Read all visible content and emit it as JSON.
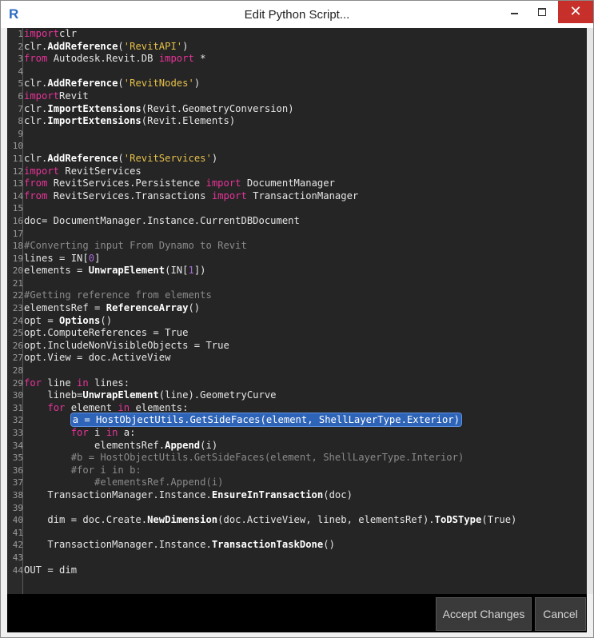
{
  "window": {
    "title": "Edit Python Script...",
    "app_icon_letter": "R",
    "close_glyph": "✕"
  },
  "editor": {
    "lines": [
      {
        "n": "1",
        "t": [
          [
            "kw",
            "import"
          ],
          [
            "",
            "clr"
          ]
        ]
      },
      {
        "n": "2",
        "t": [
          [
            "",
            "clr."
          ],
          [
            "fn",
            "AddReference"
          ],
          [
            "",
            "("
          ],
          [
            "str",
            "'RevitAPI'"
          ],
          [
            "",
            ")"
          ]
        ]
      },
      {
        "n": "3",
        "t": [
          [
            "kw",
            "from"
          ],
          [
            "",
            " Autodesk.Revit.DB "
          ],
          [
            "kw",
            "import"
          ],
          [
            "",
            " *"
          ]
        ]
      },
      {
        "n": "4",
        "t": []
      },
      {
        "n": "5",
        "t": [
          [
            "",
            "clr."
          ],
          [
            "fn",
            "AddReference"
          ],
          [
            "",
            "("
          ],
          [
            "str",
            "'RevitNodes'"
          ],
          [
            "",
            ")"
          ]
        ]
      },
      {
        "n": "6",
        "t": [
          [
            "kw",
            "import"
          ],
          [
            "",
            "",
            " "
          ],
          [
            "",
            "Revit"
          ]
        ]
      },
      {
        "n": "7",
        "t": [
          [
            "",
            "clr."
          ],
          [
            "fn",
            "ImportExtensions"
          ],
          [
            "",
            "(Revit.GeometryConversion)"
          ]
        ]
      },
      {
        "n": "8",
        "t": [
          [
            "",
            "clr."
          ],
          [
            "fn",
            "ImportExtensions"
          ],
          [
            "",
            "(Revit.Elements)"
          ]
        ]
      },
      {
        "n": "9",
        "t": []
      },
      {
        "n": "10",
        "t": []
      },
      {
        "n": "11",
        "t": [
          [
            "",
            "clr."
          ],
          [
            "fn",
            "AddReference"
          ],
          [
            "",
            "("
          ],
          [
            "str",
            "'RevitServices'"
          ],
          [
            "",
            ")"
          ]
        ]
      },
      {
        "n": "12",
        "t": [
          [
            "kw",
            "import"
          ],
          [
            "",
            " RevitServices"
          ]
        ]
      },
      {
        "n": "13",
        "t": [
          [
            "kw",
            "from"
          ],
          [
            "",
            " RevitServices.Persistence "
          ],
          [
            "kw",
            "import"
          ],
          [
            "",
            " DocumentManager"
          ]
        ]
      },
      {
        "n": "14",
        "t": [
          [
            "kw",
            "from"
          ],
          [
            "",
            " RevitServices.Transactions "
          ],
          [
            "kw",
            "import"
          ],
          [
            "",
            " TransactionManager"
          ]
        ]
      },
      {
        "n": "15",
        "t": []
      },
      {
        "n": "16",
        "t": [
          [
            "",
            "doc= DocumentManager.Instance.CurrentDBDocument"
          ]
        ]
      },
      {
        "n": "17",
        "t": []
      },
      {
        "n": "18",
        "t": [
          [
            "cm",
            "#Converting input From Dynamo to Revit"
          ]
        ]
      },
      {
        "n": "19",
        "t": [
          [
            "",
            "lines = IN["
          ],
          [
            "num",
            "0"
          ],
          [
            "",
            "]"
          ]
        ]
      },
      {
        "n": "20",
        "t": [
          [
            "",
            "elements = "
          ],
          [
            "fn",
            "UnwrapElement"
          ],
          [
            "",
            "(IN["
          ],
          [
            "num",
            "1"
          ],
          [
            "",
            "])"
          ]
        ]
      },
      {
        "n": "21",
        "t": []
      },
      {
        "n": "22",
        "t": [
          [
            "cm",
            "#Getting reference from elements"
          ]
        ]
      },
      {
        "n": "23",
        "t": [
          [
            "",
            "elementsRef = "
          ],
          [
            "fn",
            "ReferenceArray"
          ],
          [
            "",
            "()"
          ]
        ]
      },
      {
        "n": "24",
        "t": [
          [
            "",
            "opt = "
          ],
          [
            "fn",
            "Options"
          ],
          [
            "",
            "()"
          ]
        ]
      },
      {
        "n": "25",
        "t": [
          [
            "",
            "opt.ComputeReferences = True"
          ]
        ]
      },
      {
        "n": "26",
        "t": [
          [
            "",
            "opt.IncludeNonVisibleObjects = True"
          ]
        ]
      },
      {
        "n": "27",
        "t": [
          [
            "",
            "opt.View = doc.ActiveView"
          ]
        ]
      },
      {
        "n": "28",
        "t": []
      },
      {
        "n": "29",
        "t": [
          [
            "kw",
            "for"
          ],
          [
            "",
            " line "
          ],
          [
            "kw",
            "in"
          ],
          [
            "",
            " lines:"
          ]
        ]
      },
      {
        "n": "30",
        "t": [
          [
            "",
            "    lineb="
          ],
          [
            "fn",
            "UnwrapElement"
          ],
          [
            "",
            "(line).GeometryCurve"
          ]
        ]
      },
      {
        "n": "31",
        "t": [
          [
            "",
            "    "
          ],
          [
            "kw",
            "for"
          ],
          [
            "",
            " element "
          ],
          [
            "kw",
            "in"
          ],
          [
            "",
            " elements:"
          ]
        ]
      },
      {
        "n": "32",
        "t": [
          [
            "",
            "        "
          ],
          [
            "sel",
            "a = HostObjectUtils.GetSideFaces(element, ShellLayerType.Exterior)"
          ]
        ]
      },
      {
        "n": "33",
        "t": [
          [
            "",
            "        "
          ],
          [
            "kw",
            "for"
          ],
          [
            "",
            " i "
          ],
          [
            "kw",
            "in"
          ],
          [
            "",
            " a:"
          ]
        ]
      },
      {
        "n": "34",
        "t": [
          [
            "",
            "            elementsRef."
          ],
          [
            "fn",
            "Append"
          ],
          [
            "",
            "(i)"
          ]
        ]
      },
      {
        "n": "35",
        "t": [
          [
            "cm",
            "        #b = HostObjectUtils.GetSideFaces(element, ShellLayerType.Interior)"
          ]
        ]
      },
      {
        "n": "36",
        "t": [
          [
            "cm",
            "        #for i in b:"
          ]
        ]
      },
      {
        "n": "37",
        "t": [
          [
            "cm",
            "            #elementsRef.Append(i)"
          ]
        ]
      },
      {
        "n": "38",
        "t": [
          [
            "",
            "    TransactionManager.Instance."
          ],
          [
            "fn",
            "EnsureInTransaction"
          ],
          [
            "",
            "(doc)"
          ]
        ]
      },
      {
        "n": "39",
        "t": []
      },
      {
        "n": "40",
        "t": [
          [
            "",
            "    dim = doc.Create."
          ],
          [
            "fn",
            "NewDimension"
          ],
          [
            "",
            "(doc.ActiveView, lineb, elementsRef)."
          ],
          [
            "fn",
            "ToDSType"
          ],
          [
            "",
            "(True)"
          ]
        ]
      },
      {
        "n": "41",
        "t": []
      },
      {
        "n": "42",
        "t": [
          [
            "",
            "    TransactionManager.Instance."
          ],
          [
            "fn",
            "TransactionTaskDone"
          ],
          [
            "",
            "()"
          ]
        ]
      },
      {
        "n": "43",
        "t": []
      },
      {
        "n": "44",
        "t": [
          [
            "",
            "OUT = dim"
          ]
        ]
      }
    ]
  },
  "footer": {
    "accept_label": "Accept Changes",
    "cancel_label": "Cancel"
  }
}
